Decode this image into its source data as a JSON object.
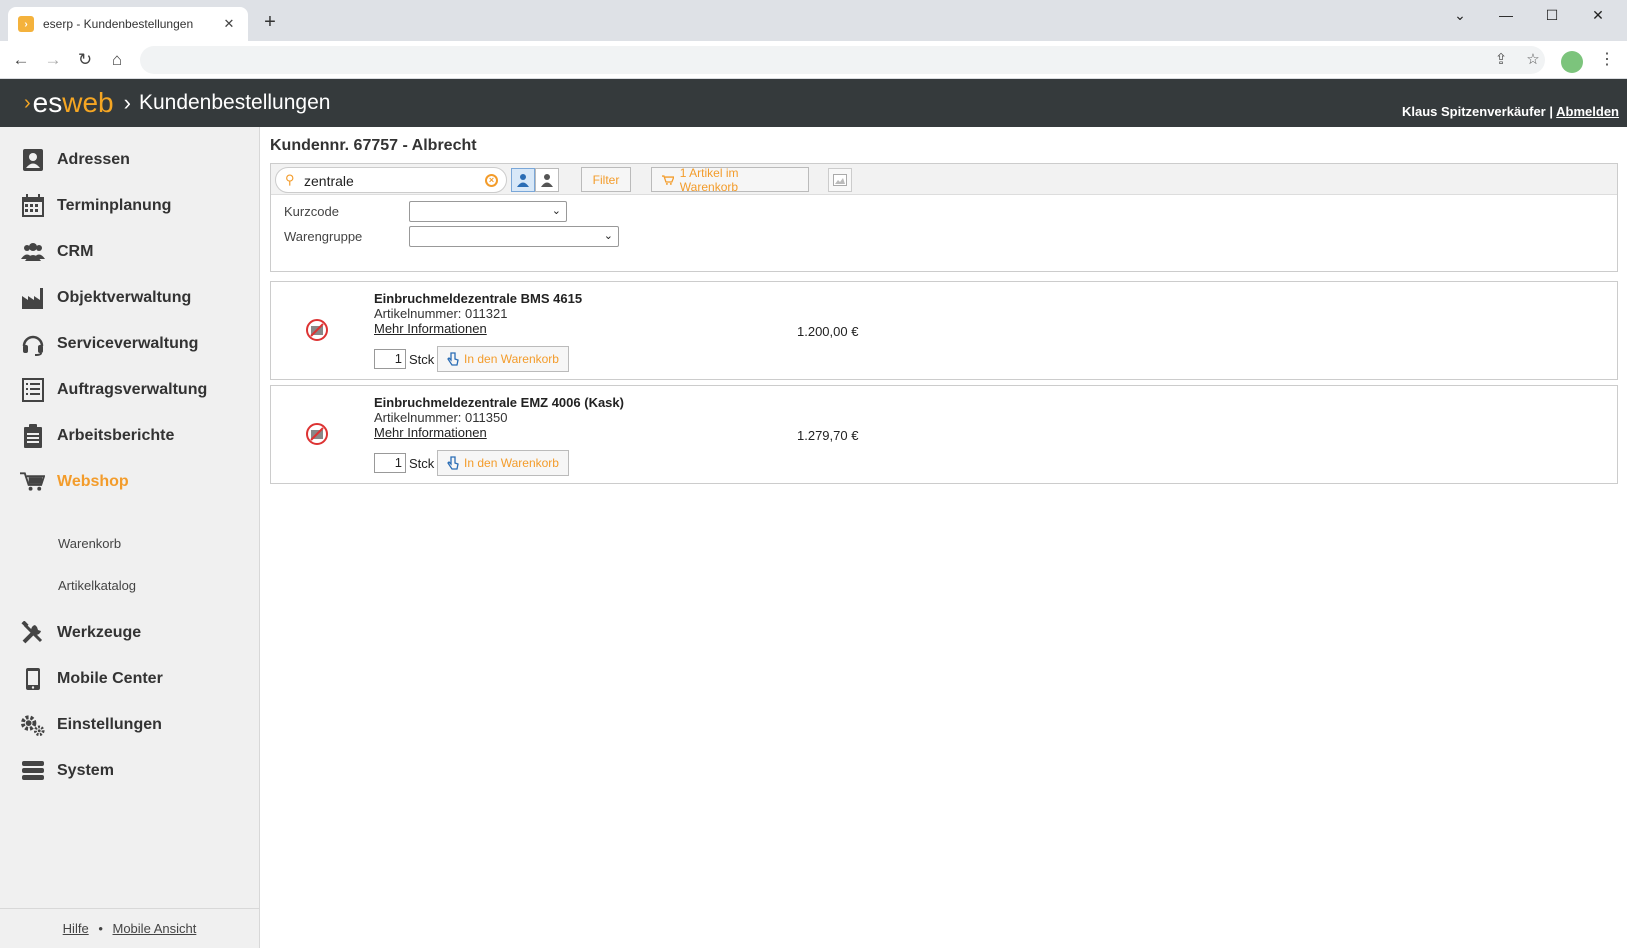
{
  "browser": {
    "tab_title": "eserp - Kundenbestellungen",
    "tab_favicon_icon": "eserp-favicon",
    "new_tab_label": "+"
  },
  "app": {
    "logo_es": "es",
    "logo_web": "web",
    "title": "Kundenbestellungen",
    "user_name": "Klaus Spitzenverkäufer",
    "separator": "|",
    "logout_label": "Abmelden",
    "accent_color": "#f39c2b",
    "header_color": "#353a3c"
  },
  "sidebar": {
    "items": [
      {
        "label": "Adressen",
        "icon": "address-book-icon"
      },
      {
        "label": "Terminplanung",
        "icon": "calendar-icon"
      },
      {
        "label": "CRM",
        "icon": "users-icon"
      },
      {
        "label": "Objektverwaltung",
        "icon": "factory-icon"
      },
      {
        "label": "Serviceverwaltung",
        "icon": "headset-icon"
      },
      {
        "label": "Auftragsverwaltung",
        "icon": "list-icon"
      },
      {
        "label": "Arbeitsberichte",
        "icon": "clipboard-icon"
      },
      {
        "label": "Webshop",
        "icon": "cart-icon",
        "active": true
      },
      {
        "label": "Werkzeuge",
        "icon": "tools-icon"
      },
      {
        "label": "Mobile Center",
        "icon": "mobile-icon"
      },
      {
        "label": "Einstellungen",
        "icon": "gears-icon"
      },
      {
        "label": "System",
        "icon": "database-icon"
      }
    ],
    "sub_items": [
      "Warenkorb",
      "Artikelkatalog"
    ],
    "footer": {
      "help": "Hilfe",
      "dot": "•",
      "mobile": "Mobile Ansicht"
    }
  },
  "main": {
    "page_title": "Kundennr. 67757 - Albrecht",
    "search_value": "zentrale",
    "filter_button": "Filter",
    "cart_button": "1 Artikel im Warenkorb",
    "filters": [
      {
        "label": "Kurzcode",
        "value": ""
      },
      {
        "label": "Warengruppe",
        "value": ""
      }
    ]
  },
  "products": [
    {
      "name": "Einbruchmeldezentrale BMS 4615",
      "article_number": "Artikelnummer: 011321",
      "more_info": "Mehr Informationen",
      "price": "1.200,00 €",
      "quantity": "1",
      "unit": "Stck",
      "add_label": "In den Warenkorb"
    },
    {
      "name": "Einbruchmeldezentrale EMZ 4006 (Kask)",
      "article_number": "Artikelnummer: 011350",
      "more_info": "Mehr Informationen",
      "price": "1.279,70 €",
      "quantity": "1",
      "unit": "Stck",
      "add_label": "In den Warenkorb"
    }
  ]
}
